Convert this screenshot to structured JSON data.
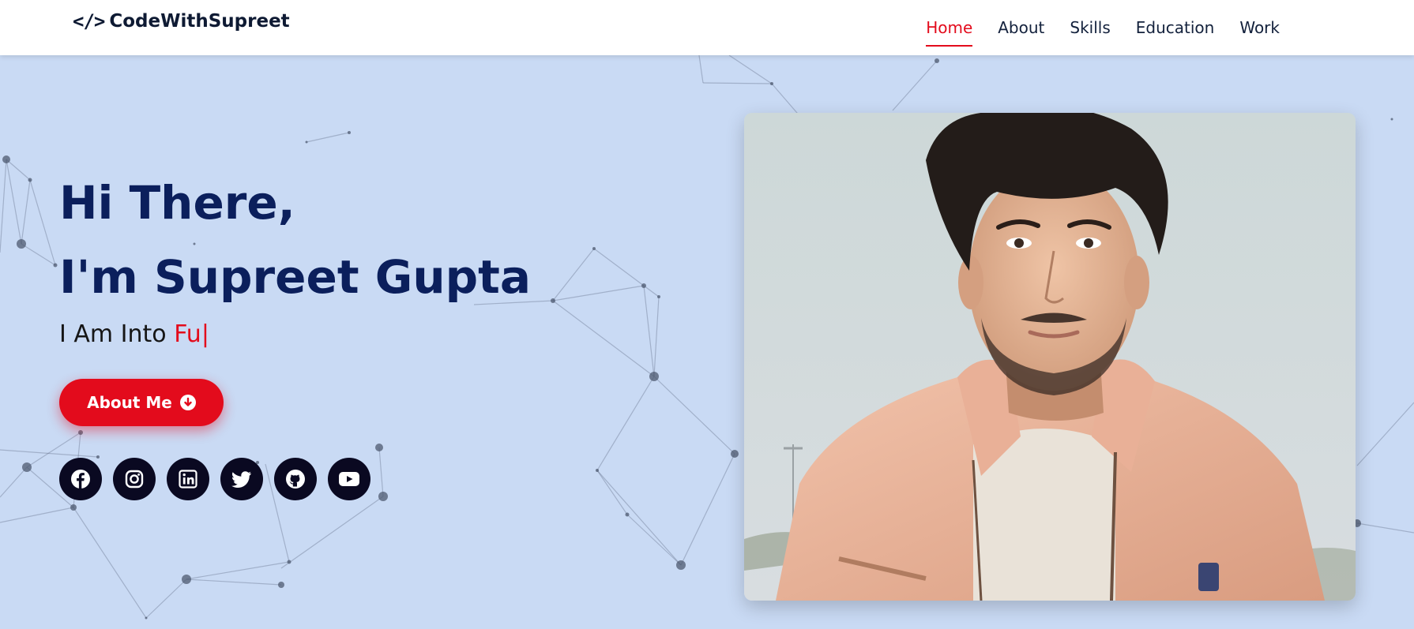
{
  "navbar": {
    "logo_icon": "</>",
    "logo_text": "CodeWithSupreet",
    "links": [
      {
        "label": "Home",
        "active": true
      },
      {
        "label": "About",
        "active": false
      },
      {
        "label": "Skills",
        "active": false
      },
      {
        "label": "Education",
        "active": false
      },
      {
        "label": "Work",
        "active": false
      }
    ]
  },
  "hero": {
    "greeting_line1": "Hi There,",
    "greeting_line2": "I'm Supreet Gupta",
    "tagline_prefix": "I Am Into ",
    "tagline_typed": "Fu|",
    "cta_label": "About Me",
    "cta_icon": "arrow-circle-down-icon",
    "socials": [
      "facebook-icon",
      "instagram-icon",
      "linkedin-icon",
      "twitter-icon",
      "github-icon",
      "youtube-icon"
    ]
  },
  "profile_photo": {
    "icon": "portrait-photo"
  },
  "colors": {
    "accent": "#e30b1c",
    "heading": "#0b1f5c",
    "background": "#c9daf4",
    "nav_bg": "#ffffff",
    "social_bg": "#0a0921"
  }
}
